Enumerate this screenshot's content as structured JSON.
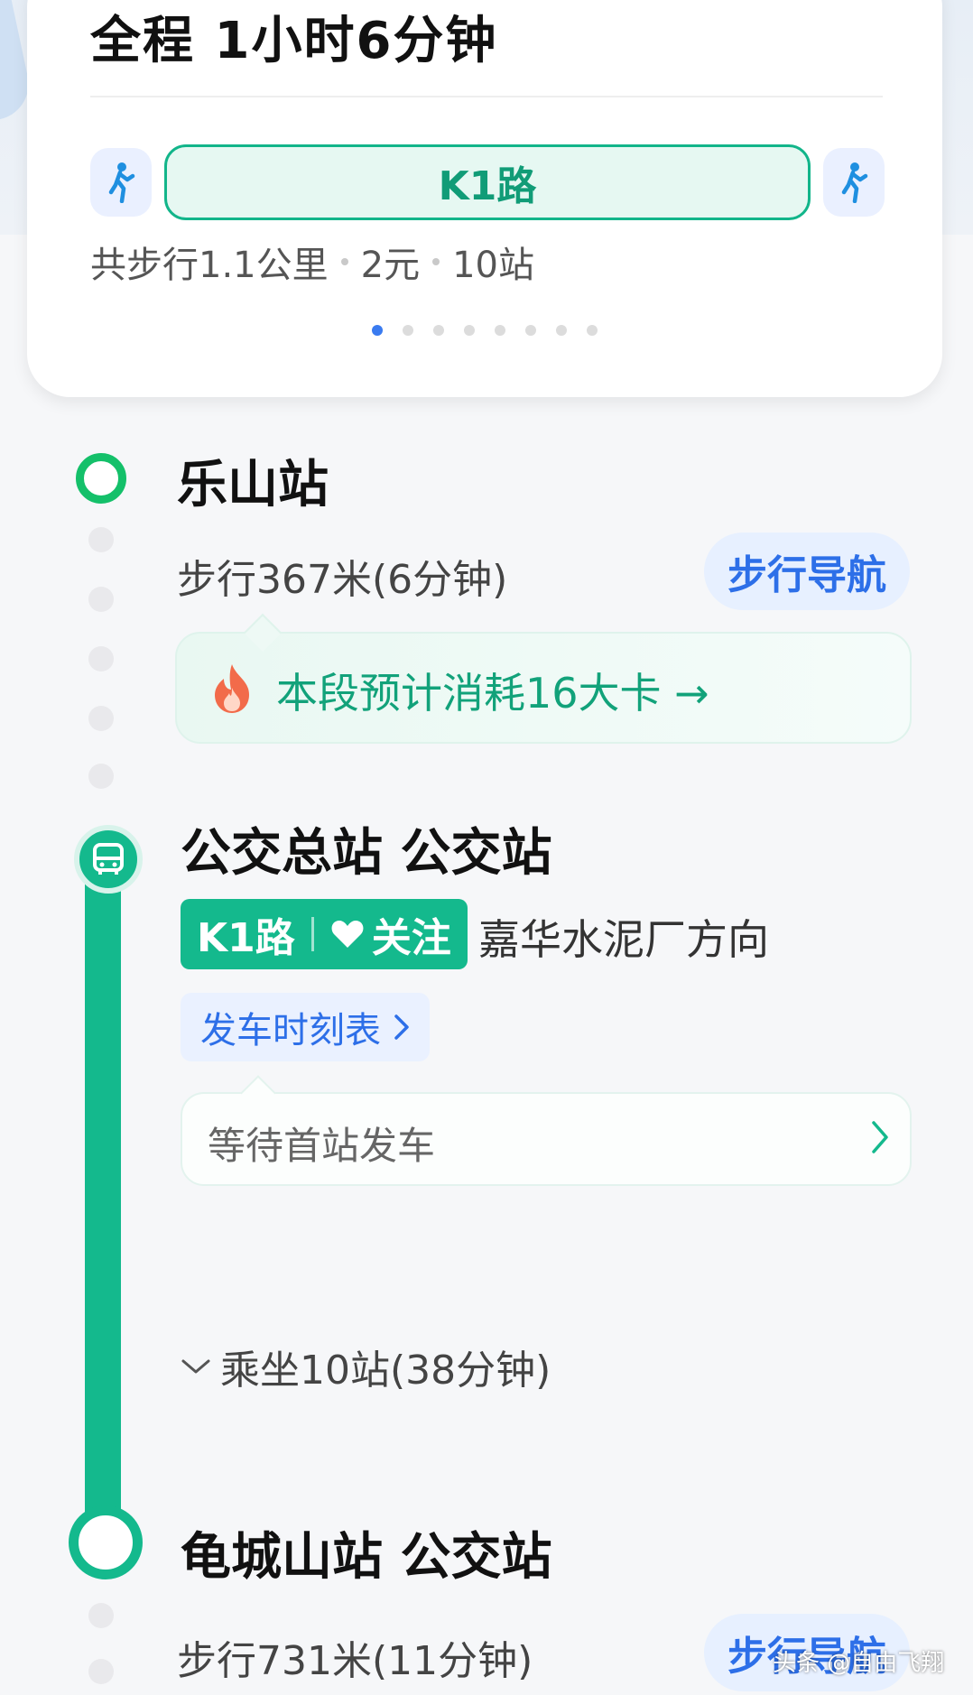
{
  "summary": {
    "total_time": "全程  1小时6分钟",
    "route_line": "K1路",
    "walk_distance": "共步行1.1公里",
    "fare": "2元",
    "stops": "10站",
    "pager_count": 8,
    "pager_active": 1
  },
  "start_station": {
    "name": "乐山站",
    "walk_info": "步行367米(6分钟)",
    "nav_button": "步行导航",
    "calorie_text": "本段预计消耗16大卡 →"
  },
  "bus_station": {
    "name": "公交总站 公交站",
    "line_label": "K1路",
    "follow_label": "关注",
    "direction": "嘉华水泥厂方向",
    "schedule_button": "发车时刻表",
    "wait_status": "等待首站发车",
    "ride_info": "乘坐10站(38分钟)"
  },
  "end_station": {
    "name": "龟城山站 公交站",
    "walk_info": "步行731米(11分钟)",
    "nav_button": "步行导航"
  },
  "watermark": "头条 @自由飞翔",
  "colors": {
    "primary_green": "#14b98d",
    "start_green": "#14c06a",
    "accent_blue": "#2d6fe8"
  }
}
